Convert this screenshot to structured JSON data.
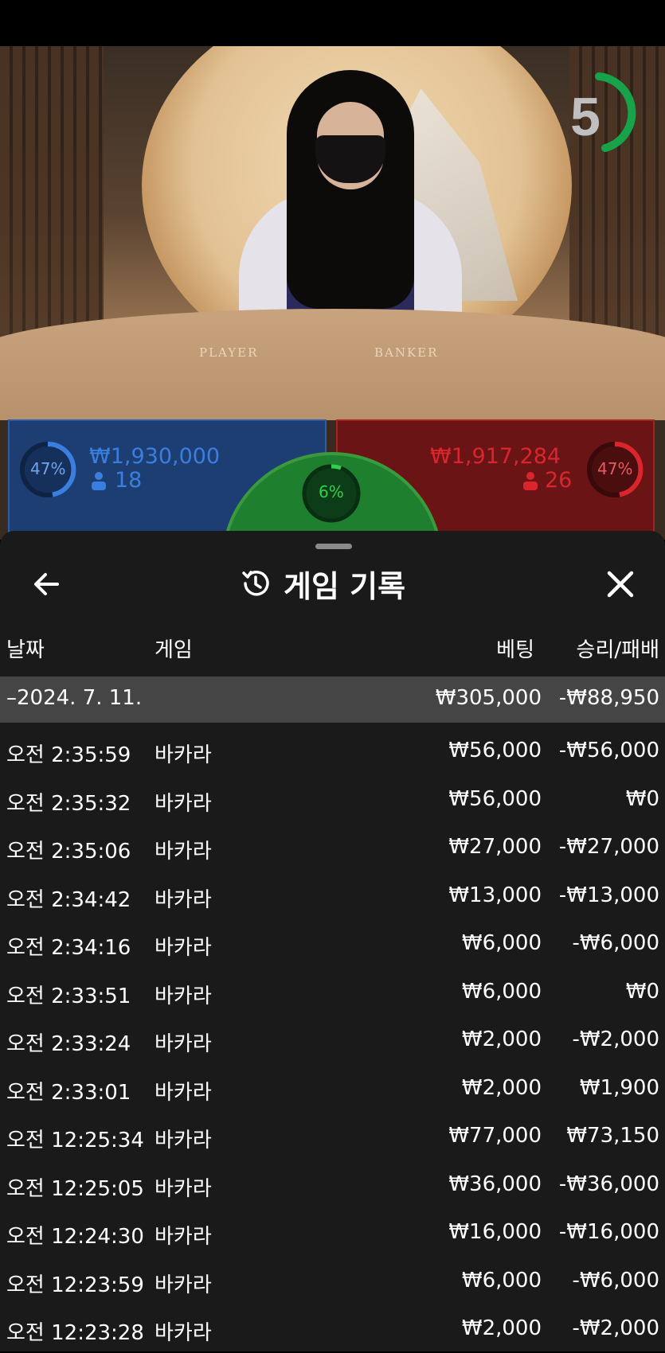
{
  "countdown": {
    "value": "5"
  },
  "bets": {
    "player": {
      "percent": "47%",
      "amount": "₩1,930,000",
      "count": "18"
    },
    "tie": {
      "percent": "6%"
    },
    "banker": {
      "percent": "47%",
      "amount": "₩1,917,284",
      "count": "26"
    }
  },
  "table_labels": {
    "player": "PLAYER",
    "banker": "BANKER"
  },
  "modal": {
    "title": "게임 기록",
    "columns": {
      "date": "날짜",
      "game": "게임",
      "bet": "베팅",
      "result": "승리/패배"
    },
    "summary": {
      "date": "–2024. 7. 11.",
      "bet": "₩305,000",
      "result": "-₩88,950"
    },
    "rows": [
      {
        "time": "오전 2:35:59",
        "game": "바카라",
        "bet": "₩56,000",
        "result": "-₩56,000"
      },
      {
        "time": "오전 2:35:32",
        "game": "바카라",
        "bet": "₩56,000",
        "result": "₩0"
      },
      {
        "time": "오전 2:35:06",
        "game": "바카라",
        "bet": "₩27,000",
        "result": "-₩27,000"
      },
      {
        "time": "오전 2:34:42",
        "game": "바카라",
        "bet": "₩13,000",
        "result": "-₩13,000"
      },
      {
        "time": "오전 2:34:16",
        "game": "바카라",
        "bet": "₩6,000",
        "result": "-₩6,000"
      },
      {
        "time": "오전 2:33:51",
        "game": "바카라",
        "bet": "₩6,000",
        "result": "₩0"
      },
      {
        "time": "오전 2:33:24",
        "game": "바카라",
        "bet": "₩2,000",
        "result": "-₩2,000"
      },
      {
        "time": "오전 2:33:01",
        "game": "바카라",
        "bet": "₩2,000",
        "result": "₩1,900"
      },
      {
        "time": "오전 12:25:34",
        "game": "바카라",
        "bet": "₩77,000",
        "result": "₩73,150"
      },
      {
        "time": "오전 12:25:05",
        "game": "바카라",
        "bet": "₩36,000",
        "result": "-₩36,000"
      },
      {
        "time": "오전 12:24:30",
        "game": "바카라",
        "bet": "₩16,000",
        "result": "-₩16,000"
      },
      {
        "time": "오전 12:23:59",
        "game": "바카라",
        "bet": "₩6,000",
        "result": "-₩6,000"
      },
      {
        "time": "오전 12:23:28",
        "game": "바카라",
        "bet": "₩2,000",
        "result": "-₩2,000"
      }
    ]
  },
  "colors": {
    "player_blue": "#3a7fe0",
    "banker_red": "#d9262c",
    "tie_green": "#1e7f2f",
    "countdown_green": "#16a34a"
  }
}
